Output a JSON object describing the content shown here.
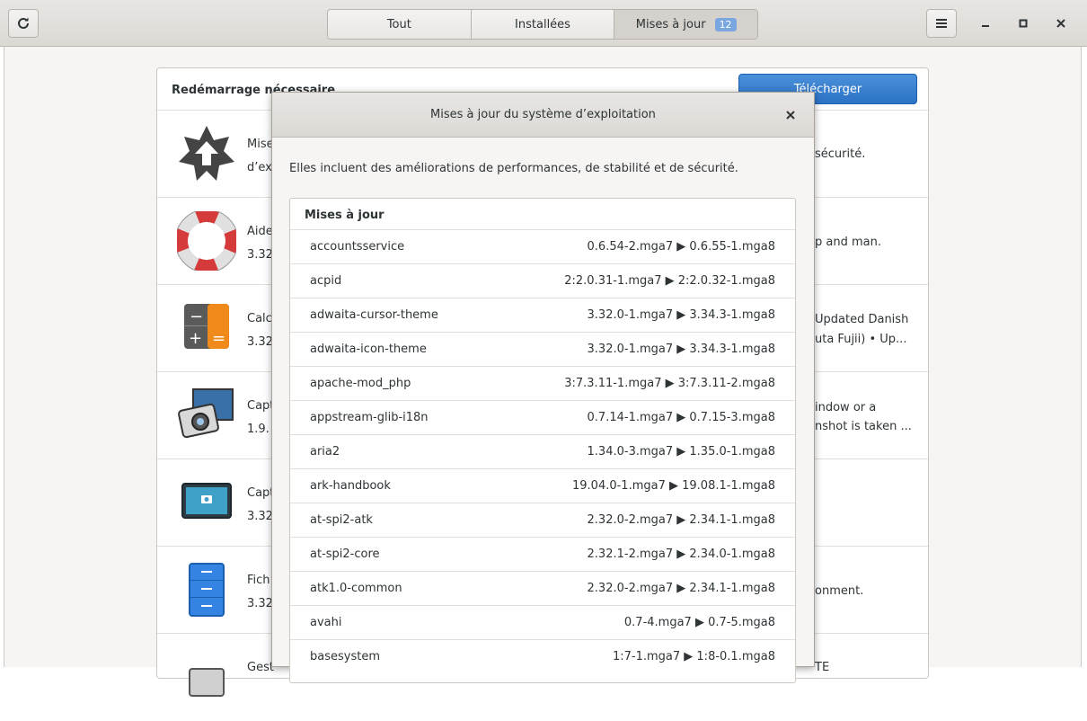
{
  "tabs": [
    {
      "label": "Tout"
    },
    {
      "label": "Installées"
    },
    {
      "label": "Mises à jour",
      "badge": "12"
    }
  ],
  "panel": {
    "header": "Redémarrage nécessaire",
    "download_label": "Télécharger",
    "apps": [
      {
        "name": "Mise",
        "name2": "d’ex",
        "version": "",
        "desc": "sécurité.",
        "desc2": "",
        "icon": "os-update-icon"
      },
      {
        "name": "Aide",
        "version": "3.32",
        "desc": "p and man.",
        "desc2": "",
        "icon": "help-lifebuoy-icon"
      },
      {
        "name": "Calc",
        "version": "3.32",
        "desc": "Updated Danish",
        "desc2": "uta Fujii)  • Up...",
        "icon": "calculator-icon"
      },
      {
        "name": "Capt",
        "version": "1.9.",
        "desc": "indow or a",
        "desc2": "nshot is taken ...",
        "icon": "camera-screenshot-icon"
      },
      {
        "name": "Capt",
        "version": "3.32",
        "desc": "",
        "desc2": "",
        "icon": "screenshot-icon"
      },
      {
        "name": "Fich",
        "version": "3.32",
        "desc": "onment.",
        "desc2": "",
        "icon": "file-cabinet-icon"
      },
      {
        "name": "Gest",
        "version": "",
        "desc": "TE",
        "desc2": "",
        "icon": "package-manager-icon"
      }
    ]
  },
  "dialog": {
    "title": "Mises à jour du système d’exploitation",
    "description": "Elles incluent des améliorations de performances, de stabilité et de sécurité.",
    "list_header": "Mises à jour",
    "packages": [
      {
        "name": "accountsservice",
        "version": "0.6.54-2.mga7 ▶ 0.6.55-1.mga8"
      },
      {
        "name": "acpid",
        "version": "2:2.0.31-1.mga7 ▶ 2:2.0.32-1.mga8"
      },
      {
        "name": "adwaita-cursor-theme",
        "version": "3.32.0-1.mga7 ▶ 3.34.3-1.mga8"
      },
      {
        "name": "adwaita-icon-theme",
        "version": "3.32.0-1.mga7 ▶ 3.34.3-1.mga8"
      },
      {
        "name": "apache-mod_php",
        "version": "3:7.3.11-1.mga7 ▶ 3:7.3.11-2.mga8"
      },
      {
        "name": "appstream-glib-i18n",
        "version": "0.7.14-1.mga7 ▶ 0.7.15-3.mga8"
      },
      {
        "name": "aria2",
        "version": "1.34.0-3.mga7 ▶ 1.35.0-1.mga8"
      },
      {
        "name": "ark-handbook",
        "version": "19.04.0-1.mga7 ▶ 19.08.1-1.mga8"
      },
      {
        "name": "at-spi2-atk",
        "version": "2.32.0-2.mga7 ▶ 2.34.1-1.mga8"
      },
      {
        "name": "at-spi2-core",
        "version": "2.32.1-2.mga7 ▶ 2.34.0-1.mga8"
      },
      {
        "name": "atk1.0-common",
        "version": "2.32.0-2.mga7 ▶ 2.34.1-1.mga8"
      },
      {
        "name": "avahi",
        "version": "0.7-4.mga7 ▶ 0.7-5.mga8"
      },
      {
        "name": "basesystem",
        "version": "1:7-1.mga7 ▶ 1:8-0.1.mga8"
      }
    ]
  }
}
